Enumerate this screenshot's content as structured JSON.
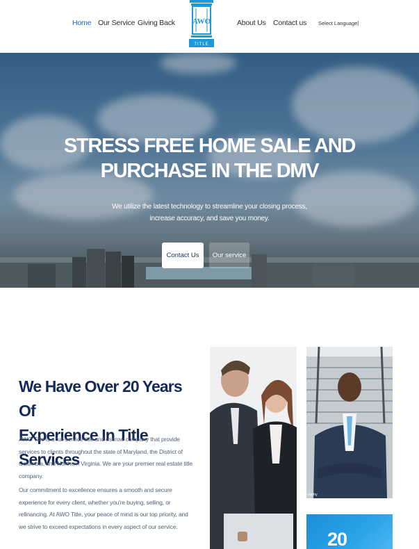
{
  "nav": {
    "items": [
      "Home",
      "Our Service",
      "Giving Back",
      "About Us",
      "Contact us"
    ],
    "active": "Home",
    "language": "Select Language",
    "logo_text": "AWO",
    "logo_sub": "TITLE"
  },
  "hero": {
    "headline_line1": "STRESS FREE HOME SALE AND",
    "headline_line2": "PURCHASE IN THE DMV",
    "subtext_line1": "We utilize the latest technology to streamline your closing process,",
    "subtext_line2": "increase accuracy, and save you money.",
    "primary_button": "Contact Us",
    "secondary_button": "Our service"
  },
  "about": {
    "title_line1": "We Have Over 20 Years Of",
    "title_line2": "Experience In Title Services",
    "paragraph1": "AWO Title is a full-service title and escrow company that provide services to clients throughout the state of Maryland, the District of Columbia, and Northern Virginia. We are your premier real estate title company.",
    "paragraph2": "Our commitment to excellence ensures a smooth and secure experience for every client, whether you're buying, selling, or refinancing. At AWO Title, your peace of mind is our top priority, and we strive to exceed expectations in every aspect of our service.",
    "photo_caption": "raphy",
    "stat_number": "20"
  },
  "colors": {
    "brand_blue": "#1f63c2",
    "title_navy": "#152a57",
    "logo_blue": "#1a9ad9",
    "stat_blue": "#1c8fd6"
  }
}
